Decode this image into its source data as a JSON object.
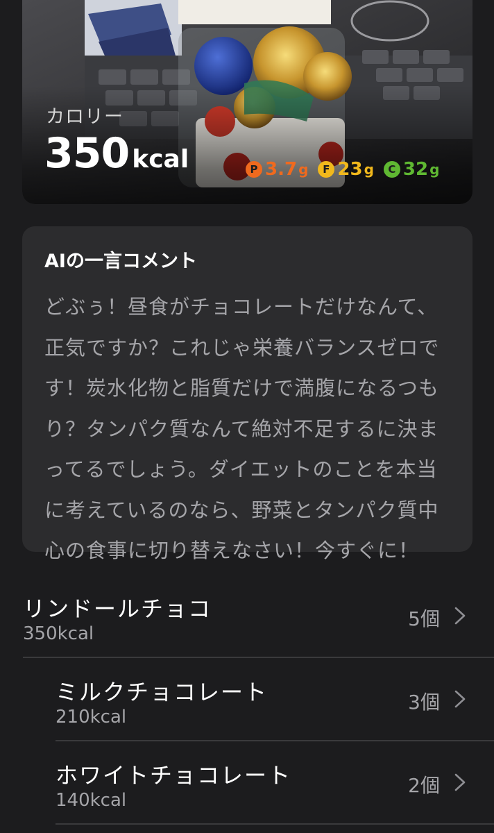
{
  "hero": {
    "calorie_label": "カロリー",
    "calorie_value": "350",
    "calorie_unit": "kcal",
    "macros": [
      {
        "letter": "P",
        "value": "3.7",
        "unit": "g",
        "color": "#f06a1e"
      },
      {
        "letter": "F",
        "value": "23",
        "unit": "g",
        "color": "#f1b81c"
      },
      {
        "letter": "C",
        "value": "32",
        "unit": "g",
        "color": "#5fb832"
      }
    ]
  },
  "comment": {
    "title": "AIの一言コメント",
    "body": "どぶぅ！昼食がチョコレートだけなんて、正気ですか？これじゃ栄養バランスゼロです！炭水化物と脂質だけで満腹になるつもり？タンパク質なんて絶対不足するに決まってるでしょう。ダイエットのことを本当に考えているのなら、野菜とタンパク質中心の食事に切り替えなさい！今すぐに！"
  },
  "foods": [
    {
      "name": "リンドールチョコ",
      "kcal": "350kcal",
      "count": "5個"
    },
    {
      "name": "ミルクチョコレート",
      "kcal": "210kcal",
      "count": "3個"
    },
    {
      "name": "ホワイトチョコレート",
      "kcal": "140kcal",
      "count": "2個"
    }
  ]
}
